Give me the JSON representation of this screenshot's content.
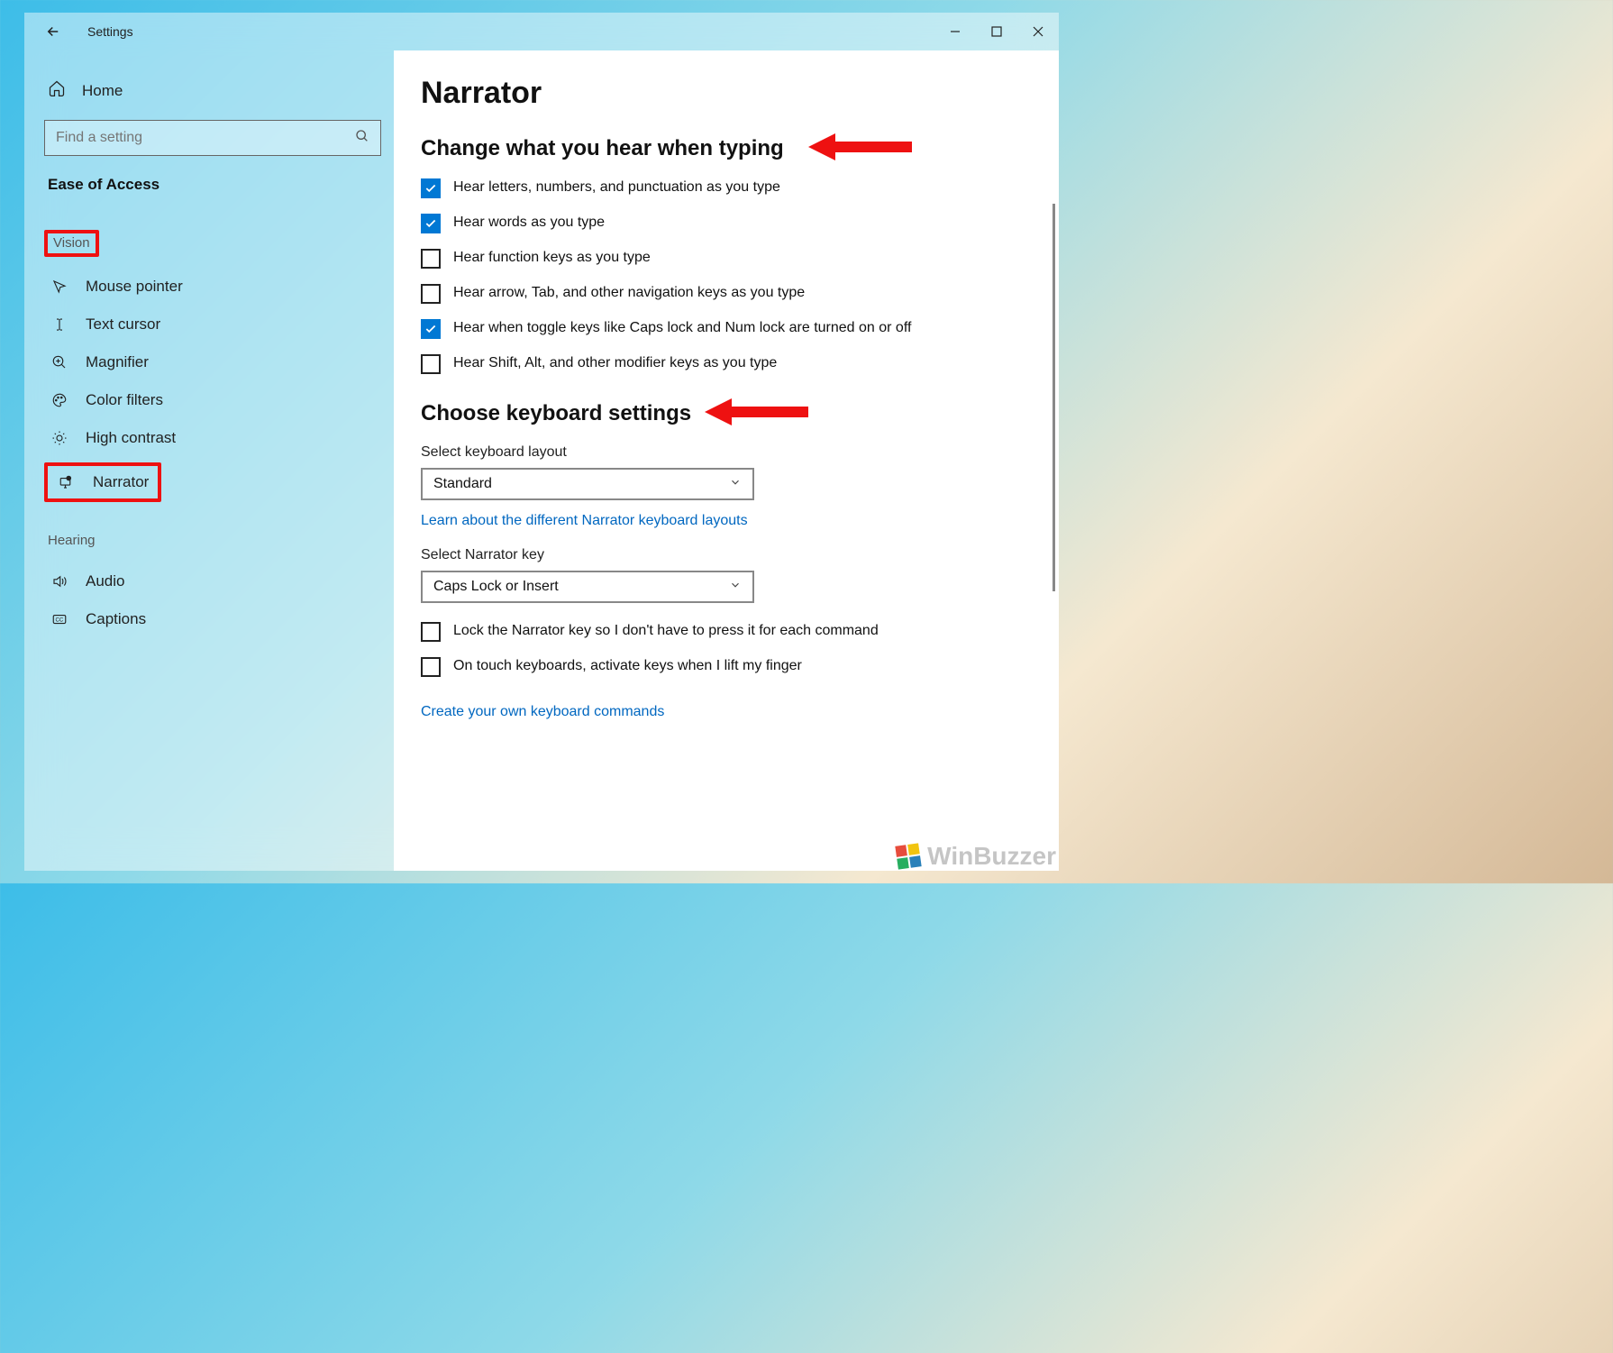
{
  "window": {
    "title": "Settings"
  },
  "sidebar": {
    "home": "Home",
    "search_placeholder": "Find a setting",
    "category": "Ease of Access",
    "group_vision": "Vision",
    "group_hearing": "Hearing",
    "items": {
      "mouse": "Mouse pointer",
      "textcursor": "Text cursor",
      "magnifier": "Magnifier",
      "colorfilters": "Color filters",
      "highcontrast": "High contrast",
      "narrator": "Narrator",
      "audio": "Audio",
      "captions": "Captions"
    }
  },
  "main": {
    "title": "Narrator",
    "section1": "Change what you hear when typing",
    "checks": {
      "c1": "Hear letters, numbers, and punctuation as you type",
      "c2": "Hear words as you type",
      "c3": "Hear function keys as you type",
      "c4": "Hear arrow, Tab, and other navigation keys as you type",
      "c5": "Hear when toggle keys like Caps lock and Num lock are turned on or off",
      "c6": "Hear Shift, Alt, and other modifier keys as you type"
    },
    "section2": "Choose keyboard settings",
    "kb_layout_label": "Select keyboard layout",
    "kb_layout_value": "Standard",
    "kb_layout_link": "Learn about the different Narrator keyboard layouts",
    "nar_key_label": "Select Narrator key",
    "nar_key_value": "Caps Lock or Insert",
    "lock_chk": "Lock the Narrator key so I don't have to press it for each command",
    "touch_chk": "On touch keyboards, activate keys when I lift my finger",
    "cmd_link": "Create your own keyboard commands"
  },
  "watermark": "WinBuzzer"
}
